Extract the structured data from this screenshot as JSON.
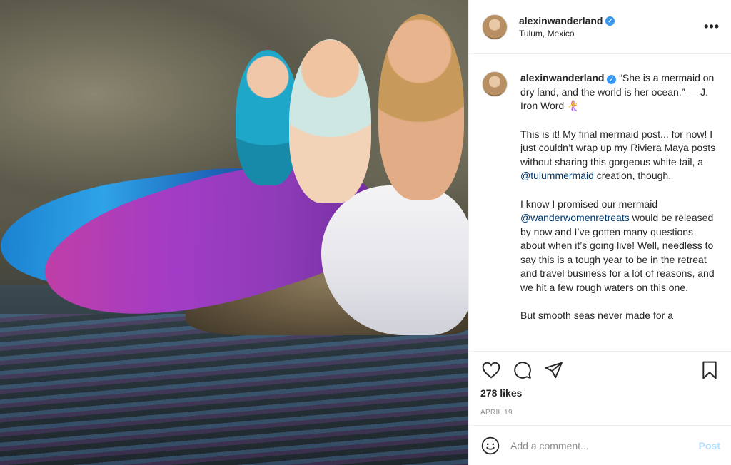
{
  "post": {
    "username": "alexinwanderland",
    "location": "Tulum, Mexico",
    "more_label": "•••"
  },
  "caption": {
    "username": "alexinwanderland",
    "paragraphs": [
      {
        "text": "“She is a mermaid on dry land, and the world is her ocean.” — J. Iron Word 🧜‍♀️"
      },
      {
        "before": "This is it! My final mermaid post... for now! I just couldn’t wrap up my Riviera Maya posts without sharing this gorgeous white tail, a ",
        "link": "@tulummermaid",
        "after": " creation, though."
      },
      {
        "before": "I know I promised our mermaid ",
        "link": "@wanderwomenretreats",
        "after": " would be released by now and I’ve gotten many questions about when it’s going live! Well, needless to say this is a tough year to be in the retreat and travel business for a lot of reasons, and we hit a few rough waters on this one."
      },
      {
        "text": "But smooth seas never made for a"
      }
    ]
  },
  "actions": {
    "likes": "278 likes",
    "date": "APRIL 19"
  },
  "comment_box": {
    "placeholder": "Add a comment...",
    "post_label": "Post"
  },
  "colors": {
    "verified": "#3897f0",
    "link": "#00376b",
    "post_disabled": "#b2dffc"
  }
}
